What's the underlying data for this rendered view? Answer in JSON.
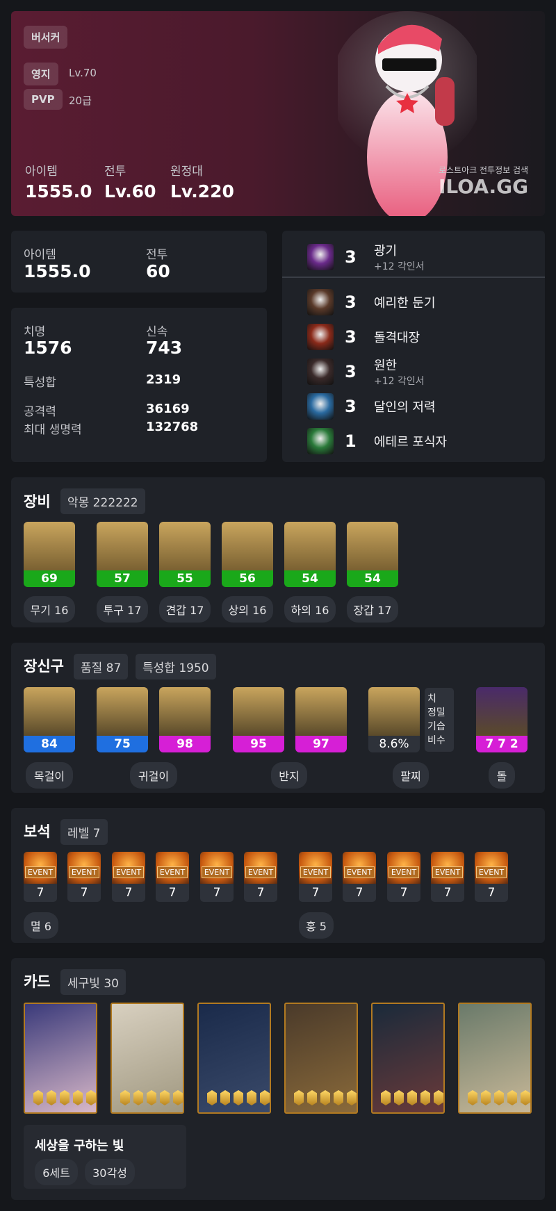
{
  "hero": {
    "class_name": "버서커",
    "estate_label": "영지",
    "estate_value": "Lv.70",
    "pvp_label": "PVP",
    "pvp_value": "20급",
    "item_label": "아이템",
    "item_value": "1555.0",
    "combat_label": "전투",
    "combat_value": "Lv.60",
    "expedition_label": "원정대",
    "expedition_value": "Lv.220",
    "watermark_small": "로스트아크 전투정보 검색",
    "watermark_logo": "ILOA.GG"
  },
  "summary": {
    "item_label": "아이템",
    "item_value": "1555.0",
    "combat_label": "전투",
    "combat_value": "60"
  },
  "stats": {
    "crit_label": "치명",
    "crit_value": "1576",
    "swift_label": "신속",
    "swift_value": "743",
    "total_label": "특성합",
    "total_value": "2319",
    "atk_label": "공격력",
    "atk_value": "36169",
    "hp_label": "최대 생명력",
    "hp_value": "132768"
  },
  "engravings": [
    {
      "level": "3",
      "name": "광기",
      "sub": "+12 각인서",
      "color": "#6a2a8a"
    },
    {
      "level": "3",
      "name": "예리한 둔기",
      "sub": "",
      "color": "#5a3a2a"
    },
    {
      "level": "3",
      "name": "돌격대장",
      "sub": "",
      "color": "#8a2a1a"
    },
    {
      "level": "3",
      "name": "원한",
      "sub": "+12 각인서",
      "color": "#3a2a2a"
    },
    {
      "level": "3",
      "name": "달인의 저력",
      "sub": "",
      "color": "#2a6aa0"
    },
    {
      "level": "1",
      "name": "에테르 포식자",
      "sub": "",
      "color": "#2a7a3a"
    }
  ],
  "equipment": {
    "title": "장비",
    "tag": "악몽 222222",
    "items": [
      {
        "quality": "69",
        "label": "무기 16",
        "color": "#1aa81a"
      },
      {
        "quality": "57",
        "label": "투구 17",
        "color": "#1aa81a"
      },
      {
        "quality": "55",
        "label": "견갑 17",
        "color": "#1aa81a"
      },
      {
        "quality": "56",
        "label": "상의 16",
        "color": "#1aa81a"
      },
      {
        "quality": "54",
        "label": "하의 16",
        "color": "#1aa81a"
      },
      {
        "quality": "54",
        "label": "장갑 17",
        "color": "#1aa81a"
      }
    ]
  },
  "accessory": {
    "title": "장신구",
    "tag_quality": "품질 87",
    "tag_total": "특성합 1950",
    "items": [
      {
        "quality": "84",
        "color": "#1f6fe0"
      },
      {
        "quality": "75",
        "color": "#1f6fe0"
      },
      {
        "quality": "98",
        "color": "#d61fd6"
      },
      {
        "quality": "95",
        "color": "#d61fd6"
      },
      {
        "quality": "97",
        "color": "#d61fd6"
      },
      {
        "quality": "8.6%",
        "color": "#2e323a"
      },
      {
        "quality": "7 7 2",
        "color": "#d61fd6"
      }
    ],
    "bracelet_effects": [
      "치",
      "정밀",
      "기습",
      "비수"
    ],
    "labels": {
      "necklace": "목걸이",
      "earring": "귀걸이",
      "ring": "반지",
      "bracelet": "팔찌",
      "stone": "돌"
    }
  },
  "gems": {
    "title": "보석",
    "tag": "레벨 7",
    "event_label": "EVENT",
    "levels": [
      "7",
      "7",
      "7",
      "7",
      "7",
      "7",
      "7",
      "7",
      "7",
      "7",
      "7"
    ],
    "left_label": "멸 6",
    "right_label": "홍 5"
  },
  "cards": {
    "title": "카드",
    "tag": "세구빛 30",
    "set_name": "세상을 구하는 빛",
    "set_count": "6세트",
    "awaken": "30각성",
    "awakening_per_card": [
      5,
      5,
      5,
      5,
      5,
      5
    ]
  }
}
